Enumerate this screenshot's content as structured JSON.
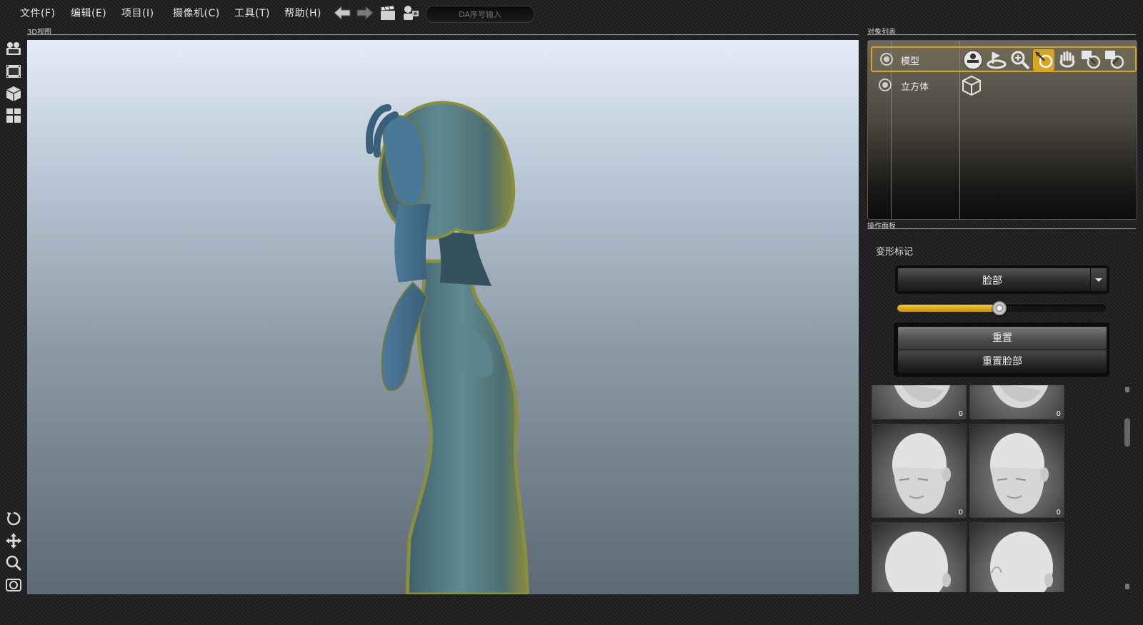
{
  "menu": {
    "items": [
      {
        "label": "文件(F)"
      },
      {
        "label": "编辑(E)"
      },
      {
        "label": "项目(I)"
      },
      {
        "label": "摄像机(C)"
      },
      {
        "label": "工具(T)"
      },
      {
        "label": "帮助(H)"
      }
    ],
    "da_input_placeholder": "DA序号输入"
  },
  "toolbar_icons": [
    "arrow-left-icon",
    "arrow-right-icon",
    "clapperboard-icon",
    "user-camera-icon"
  ],
  "left_toolbar_icons": [
    "camera-icon",
    "film-icon",
    "cube-icon",
    "grid-icon",
    "rotate-icon",
    "move-icon",
    "zoom-icon",
    "screenshot-icon"
  ],
  "viewport": {
    "label": "3D视图"
  },
  "object_list": {
    "label": "对象列表",
    "rows": [
      {
        "name": "模型",
        "selected": true
      },
      {
        "name": "立方体",
        "selected": false
      }
    ],
    "model_tools": [
      "pose-icon",
      "rotate-base-icon",
      "zoom-in-icon",
      "move-edit-icon",
      "hand-icon",
      "rotate-x-icon",
      "rotate-y-icon"
    ]
  },
  "operation_panel": {
    "label": "操作面板",
    "title": "变形标记",
    "region": "脸部",
    "slider_value": 0.49,
    "reset_label": "重置",
    "reset_face_label": "重置脸部"
  },
  "thumbnails": [
    {
      "count": "0"
    },
    {
      "count": "0"
    },
    {
      "count": "0"
    },
    {
      "count": "0"
    },
    {
      "count": ""
    },
    {
      "count": ""
    }
  ],
  "colors": {
    "accent": "#d8a520",
    "slider": "#e8b82a"
  }
}
